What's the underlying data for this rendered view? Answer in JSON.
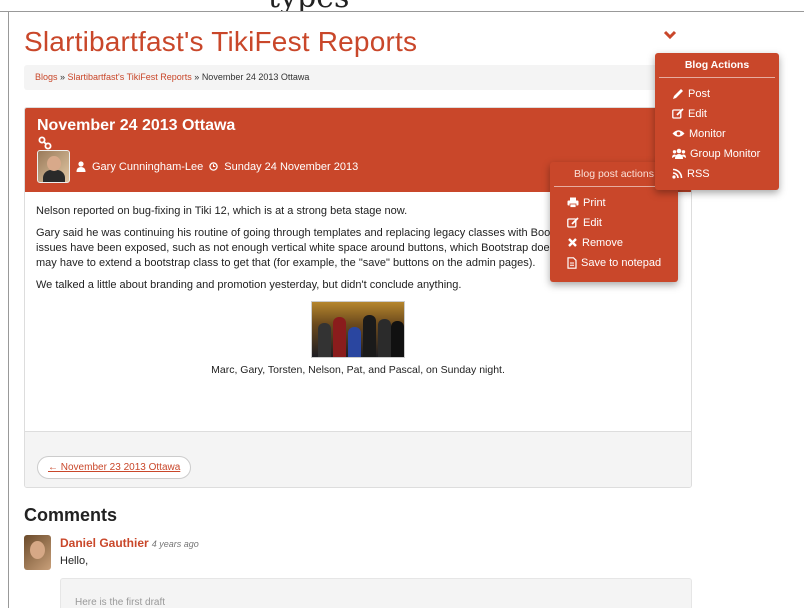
{
  "top_strip_text": "types",
  "site": {
    "title": "Slartibartfast's TikiFest Reports"
  },
  "breadcrumb": {
    "blogs": "Blogs",
    "sep1": " » ",
    "blog": "Slartibartfast's TikiFest Reports",
    "sep2": " » ",
    "current": "November 24 2013 Ottawa"
  },
  "post": {
    "title": "November 24 2013 Ottawa",
    "author": "Gary Cunningham-Lee",
    "date": "Sunday 24 November 2013",
    "paragraphs": [
      "Nelson reported on bug-fixing in Tiki 12, which is at a strong beta stage now.",
      "Gary said he was continuing his routine of going through templates and replacing legacy classes with Bootstr",
      "issues have been exposed, such as not enough vertical white space around buttons, which Bootstrap doesn't",
      "may have to extend a bootstrap class to get that (for example, the \"save\" buttons on the admin pages).",
      "We talked a little about branding and promotion yesterday, but didn't conclude anything."
    ],
    "caption": "Marc, Gary, Torsten, Nelson, Pat, and Pascal, on Sunday night.",
    "prev_link": "← November 23 2013 Ottawa"
  },
  "comments": {
    "title": "Comments",
    "items": [
      {
        "author": "Daniel Gauthier",
        "time": "4 years ago",
        "text": "Hello,",
        "quote": "Here is the first draft"
      }
    ]
  },
  "blog_actions": {
    "header": "Blog Actions",
    "items": [
      {
        "label": "Post",
        "icon": "pencil-icon"
      },
      {
        "label": "Edit",
        "icon": "edit-icon"
      },
      {
        "label": "Monitor",
        "icon": "eye-icon"
      },
      {
        "label": "Group Monitor",
        "icon": "group-icon"
      },
      {
        "label": "RSS",
        "icon": "rss-icon"
      }
    ]
  },
  "post_actions": {
    "header": "Blog post actions",
    "items": [
      {
        "label": "Print",
        "icon": "print-icon"
      },
      {
        "label": "Edit",
        "icon": "edit-icon"
      },
      {
        "label": "Remove",
        "icon": "remove-icon"
      },
      {
        "label": "Save to notepad",
        "icon": "notepad-icon"
      }
    ]
  },
  "colors": {
    "accent": "#c9472a",
    "panel_bg": "#f4f4f4"
  }
}
